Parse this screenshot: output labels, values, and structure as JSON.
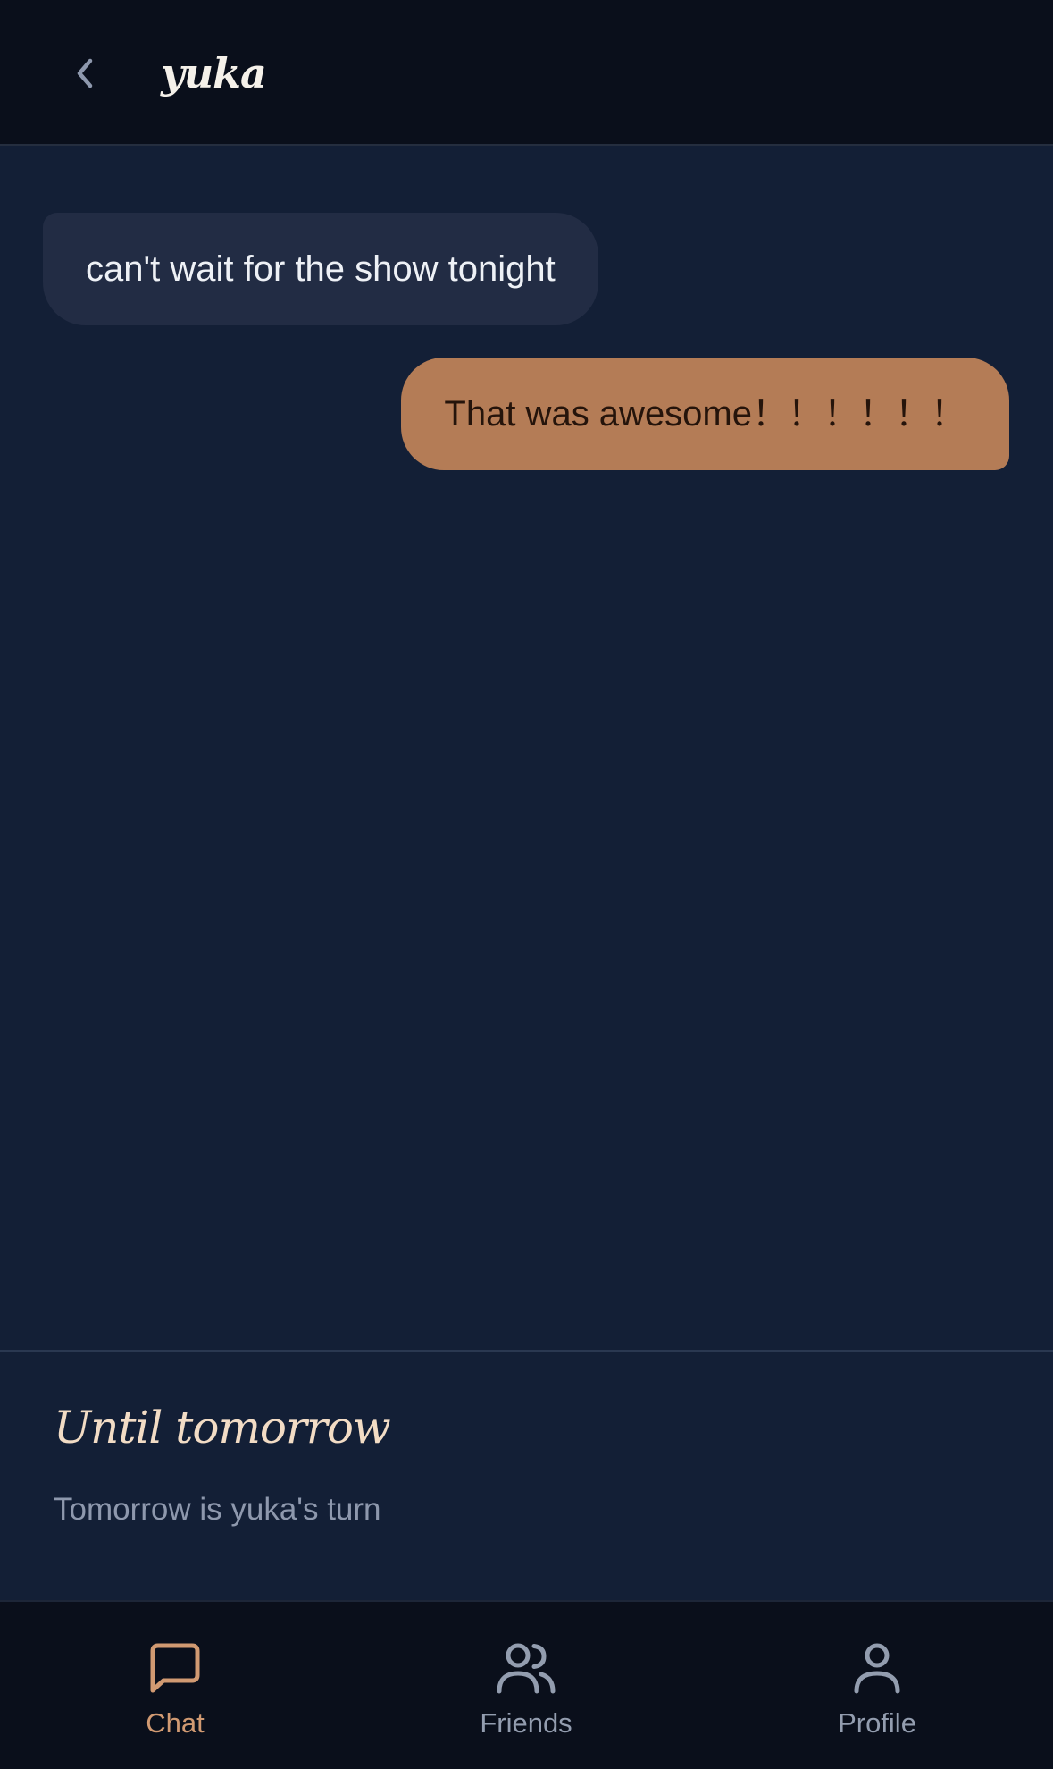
{
  "header": {
    "title": "yuka",
    "back_icon": "chevron-left-icon"
  },
  "messages": [
    {
      "direction": "incoming",
      "text": "can't wait for the show tonight"
    },
    {
      "direction": "outgoing",
      "text": "That was awesome！！！！！！"
    }
  ],
  "status": {
    "title": "Until tomorrow",
    "subtitle": "Tomorrow is yuka's turn"
  },
  "tabs": [
    {
      "label": "Chat",
      "icon": "chat-bubble-icon",
      "active": true
    },
    {
      "label": "Friends",
      "icon": "users-icon",
      "active": false
    },
    {
      "label": "Profile",
      "icon": "user-icon",
      "active": false
    }
  ],
  "colors": {
    "background": "#131f36",
    "header_bg": "#0a0f1b",
    "accent": "#b47c56",
    "active_tab": "#d19a72",
    "inactive_tab": "#939daf"
  }
}
